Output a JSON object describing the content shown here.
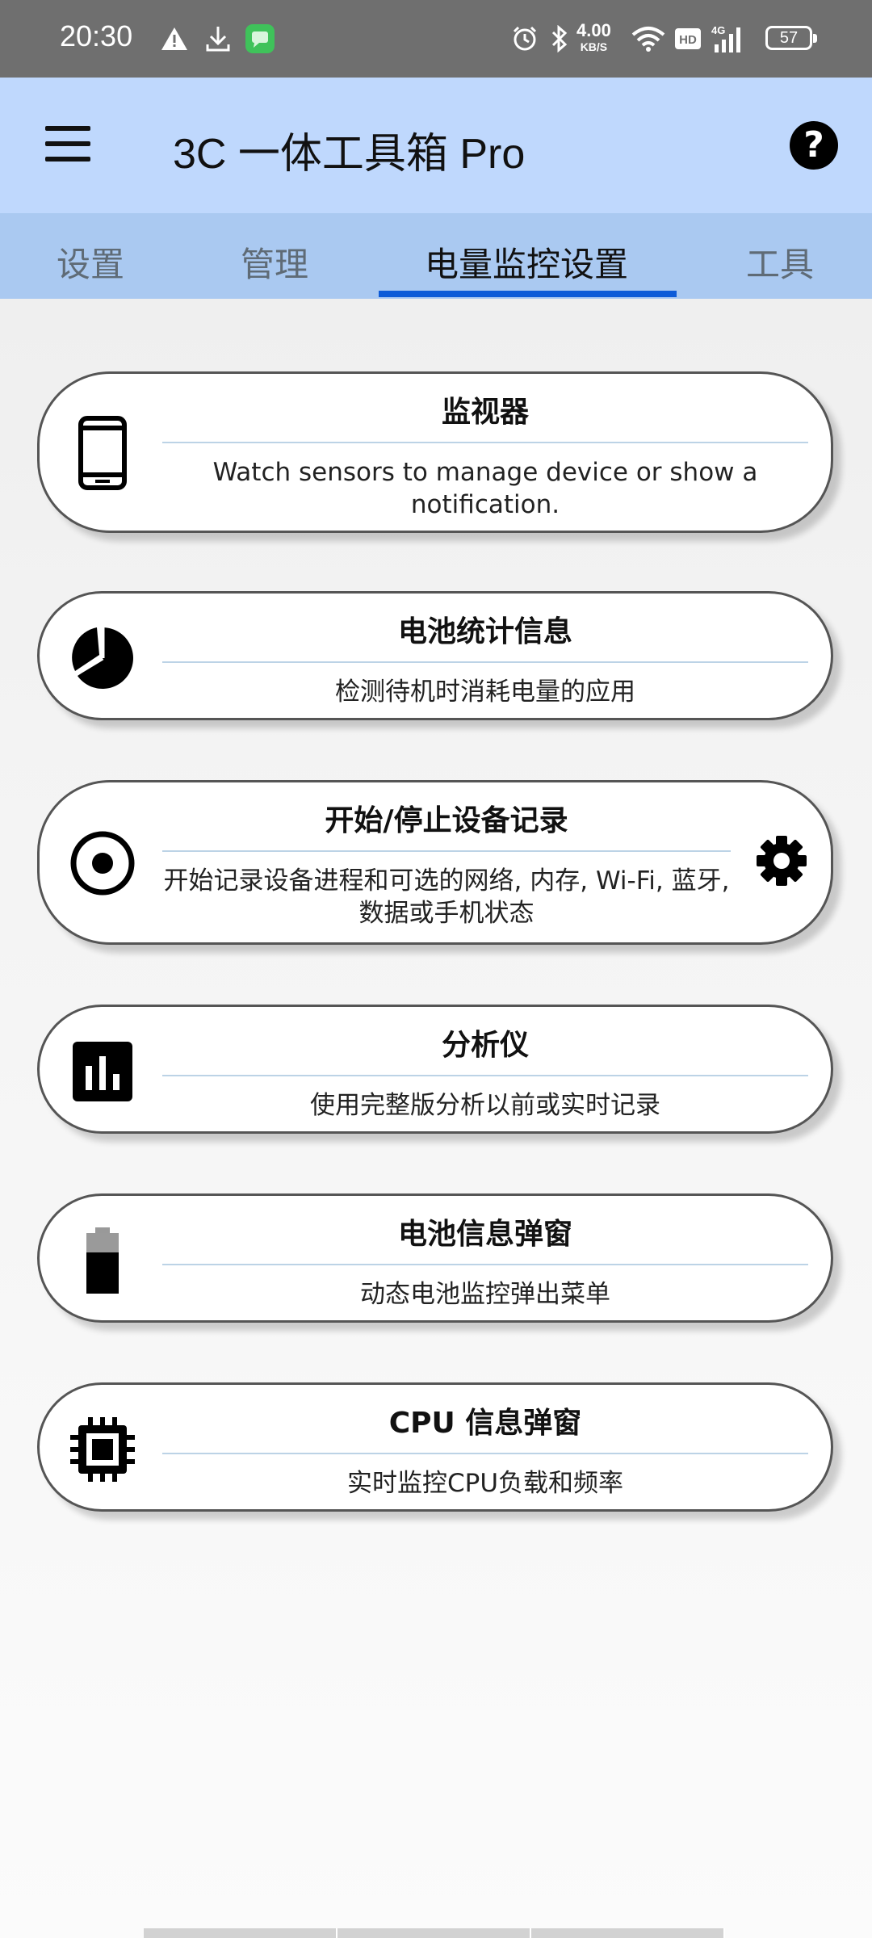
{
  "status_bar": {
    "time": "20:30",
    "net_speed_value": "4.00",
    "net_speed_unit": "KB/S",
    "hd_label": "HD",
    "signal_label": "4G",
    "battery_level": "57",
    "icons": [
      "warning-icon",
      "download-icon",
      "message-app-icon",
      "alarm-icon",
      "bluetooth-icon",
      "wifi-icon",
      "hd-icon",
      "signal-icon",
      "battery-icon"
    ]
  },
  "app_bar": {
    "title": "3C 一体工具箱 Pro",
    "menu_icon": "hamburger-menu-icon",
    "help_icon": "help-icon",
    "help_glyph": "?"
  },
  "tabs": [
    {
      "label": "设置",
      "active": false
    },
    {
      "label": "管理",
      "active": false
    },
    {
      "label": "电量监控设置",
      "active": true
    },
    {
      "label": "工具",
      "active": false
    }
  ],
  "cards": [
    {
      "icon": "phone-icon",
      "title": "监视器",
      "description": "Watch sensors to manage device or show a notification."
    },
    {
      "icon": "pie-chart-icon",
      "title": "电池统计信息",
      "description": "检测待机时消耗电量的应用"
    },
    {
      "icon": "record-icon",
      "title": "开始/停止设备记录",
      "description": "开始记录设备进程和可选的网络, 内存, Wi-Fi, 蓝牙, 数据或手机状态",
      "settings_icon": "gear-icon"
    },
    {
      "icon": "bar-chart-icon",
      "title": "分析仪",
      "description": "使用完整版分析以前或实时记录"
    },
    {
      "icon": "battery-icon",
      "title": "电池信息弹窗",
      "description": "动态电池监控弹出菜单"
    },
    {
      "icon": "cpu-chip-icon",
      "title": "CPU 信息弹窗",
      "description": "实时监控CPU负载和频率"
    }
  ],
  "colors": {
    "status_bar": "#6f6f6f",
    "app_bar": "#bfd8fd",
    "tab_bar": "#aac9f1",
    "tab_indicator": "#0d5bd8",
    "card_border": "#555555"
  }
}
